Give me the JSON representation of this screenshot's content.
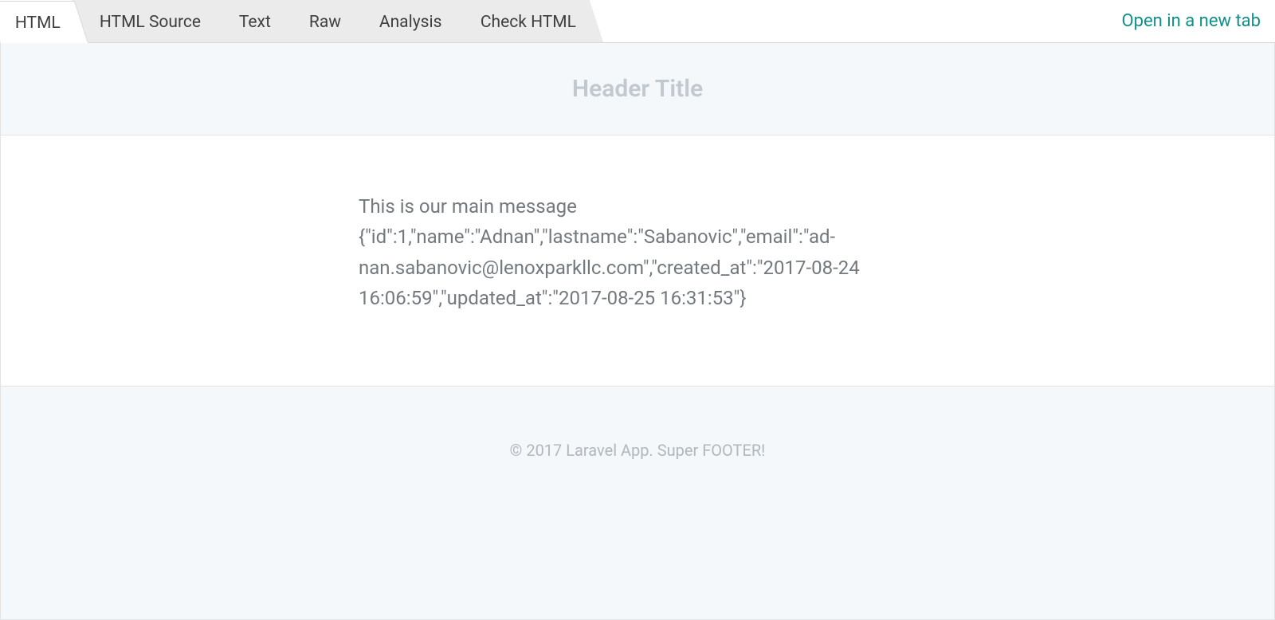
{
  "tabs": [
    {
      "label": "HTML",
      "active": true
    },
    {
      "label": "HTML Source",
      "active": false
    },
    {
      "label": "Text",
      "active": false
    },
    {
      "label": "Raw",
      "active": false
    },
    {
      "label": "Analysis",
      "active": false
    },
    {
      "label": "Check HTML",
      "active": false
    }
  ],
  "open_link": "Open in a new tab",
  "header": {
    "title": "Header Title"
  },
  "body": {
    "line1": "This is our main message",
    "line2": "{\"id\":1,\"name\":\"Adnan\",\"lastname\":\"Sabanovic\",\"email\":\"ad­nan.sabanovic@lenoxparkllc.com\",\"created_at\":\"2017-08-24 16:06:59\",\"updated_at\":\"2017-08-25 16:31:53\"}"
  },
  "footer": {
    "text": "© 2017 Laravel App. Super FOOTER!"
  }
}
